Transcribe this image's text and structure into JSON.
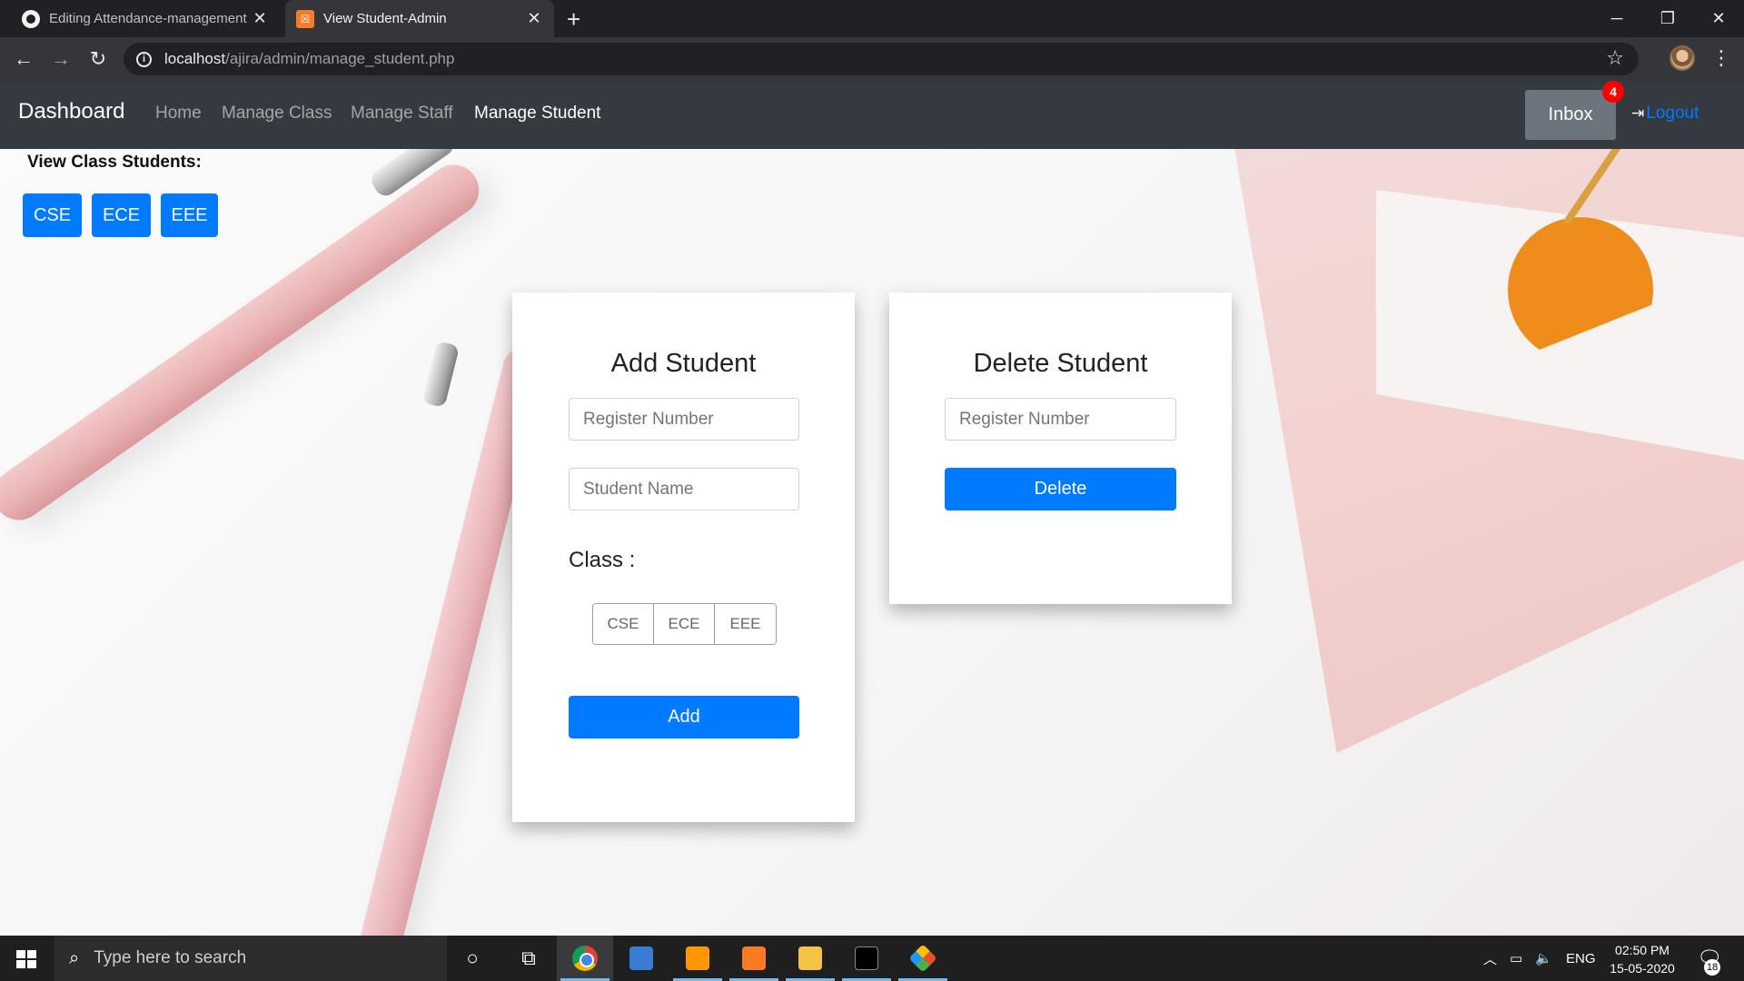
{
  "browser": {
    "tabs": [
      {
        "title": "Editing Attendance-management",
        "active": false,
        "icon": "github-icon"
      },
      {
        "title": "View Student-Admin",
        "active": true,
        "icon": "xampp-icon"
      }
    ],
    "new_tab": "+",
    "window_controls": {
      "minimize": "─",
      "restore": "❐",
      "close": "✕"
    },
    "url_host": "localhost",
    "url_path": "/ajira/admin/manage_student.php"
  },
  "navbar": {
    "brand": "Dashboard",
    "links": [
      "Home",
      "Manage Class",
      "Manage Staff",
      "Manage Student"
    ],
    "active_link": "Manage Student",
    "inbox_label": "Inbox",
    "inbox_badge": "4",
    "logout_label": "Logout"
  },
  "view_class": {
    "label": "View Class Students:",
    "buttons": [
      "CSE",
      "ECE",
      "EEE"
    ]
  },
  "add_student": {
    "title": "Add Student",
    "register_placeholder": "Register Number",
    "name_placeholder": "Student Name",
    "class_label": "Class :",
    "class_options": [
      "CSE",
      "ECE",
      "EEE"
    ],
    "submit_label": "Add"
  },
  "delete_student": {
    "title": "Delete Student",
    "register_placeholder": "Register Number",
    "submit_label": "Delete"
  },
  "taskbar": {
    "search_placeholder": "Type here to search",
    "language": "ENG",
    "time": "02:50 PM",
    "date": "15-05-2020",
    "notifications": "18"
  },
  "colors": {
    "primary": "#007bff",
    "navbar": "#343a40",
    "inbox": "#6c757d",
    "badge": "#ff0000"
  }
}
